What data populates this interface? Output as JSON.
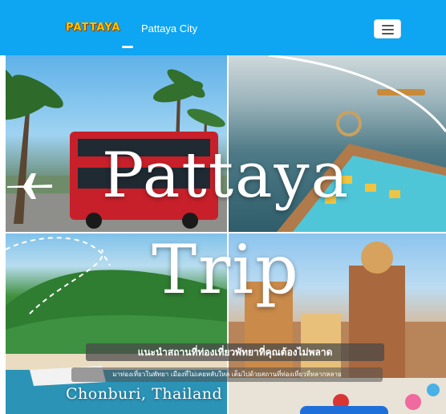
{
  "navbar": {
    "brand": "PATTAYA",
    "link": "Pattaya City",
    "toggle_icon": "hamburger-menu-icon"
  },
  "hero": {
    "title_line1": "Pattaya",
    "title_line2": "Trip",
    "subtitle": "แนะนำสถานที่ท่องเที่ยวพัทยาที่คุณต้องไม่พลาด",
    "description": "มาท่องเที่ยวในพัทยา เมืองที่ไม่เคยหลับใหล เต็มไปด้วยสถานที่ท่องเที่ยวที่หลากหลาย",
    "location": "Chonburi, Thailand",
    "icons": [
      "airplane-icon",
      "dashed-flight-path"
    ]
  },
  "colors": {
    "navbar_bg": "#0ea5f2",
    "brand": "#f6c400",
    "button": "#1e6fd9"
  }
}
